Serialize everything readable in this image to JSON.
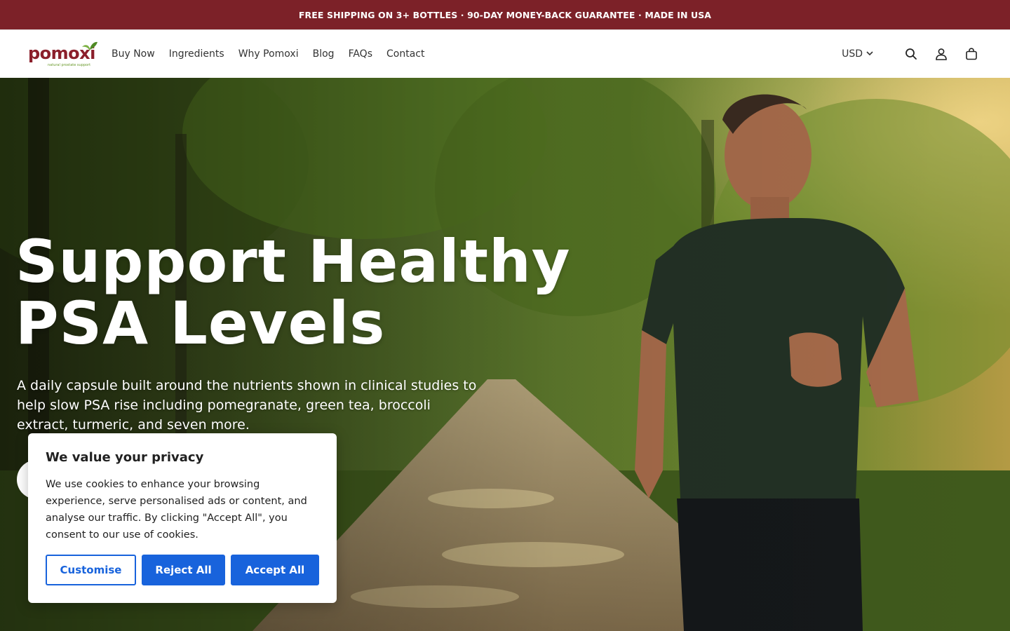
{
  "announcement": {
    "text": "FREE SHIPPING ON 3+ BOTTLES · 90-DAY MONEY-BACK GUARANTEE · MADE IN USA"
  },
  "header": {
    "logo": {
      "name": "pomoxi",
      "tagline": "natural prostate support"
    },
    "nav": [
      "Buy Now",
      "Ingredients",
      "Why Pomoxi",
      "Blog",
      "FAQs",
      "Contact"
    ],
    "currency": "USD",
    "icons": [
      "search-icon",
      "account-icon",
      "cart-icon"
    ]
  },
  "hero": {
    "title_line1": "Support Healthy",
    "title_line2": "PSA Levels",
    "subtitle": "A daily capsule built around the nutrients shown in clinical studies to help slow PSA rise including pomegranate, green tea, broccoli extract, turmeric, and seven more."
  },
  "cookie_banner": {
    "title": "We value your privacy",
    "body": "We use cookies to enhance your browsing experience, serve personalised ads or content, and analyse our traffic. By clicking \"Accept All\", you consent to our use of cookies.",
    "buttons": {
      "customise": "Customise",
      "reject": "Reject All",
      "accept": "Accept All"
    }
  },
  "colors": {
    "announcement_bg": "#7c2128",
    "brand": "#8b1f2b",
    "leaf": "#6a9a2c",
    "cookie_accent": "#1863dc"
  }
}
